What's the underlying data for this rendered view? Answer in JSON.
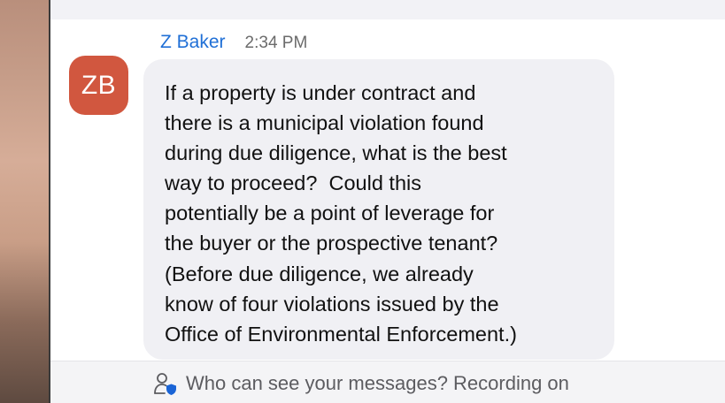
{
  "message": {
    "avatar_initials": "ZB",
    "sender": "Z Baker",
    "time": "2:34 PM",
    "lines": [
      "If a property is under contract and",
      "there is a municipal violation found",
      "during due diligence, what is the best",
      "way to proceed?  Could this",
      "potentially be a point of leverage for",
      "the buyer or the prospective tenant?",
      "(Before due diligence, we already",
      "know of four violations issued by the",
      "Office of Environmental Enforcement.)"
    ]
  },
  "footer": {
    "privacy_text": "Who can see your messages? Recording on",
    "icon": "user-shield-icon"
  },
  "colors": {
    "avatar_bg": "#d1573f",
    "sender_name": "#1f6fd6",
    "bubble_bg": "#f0f0f4",
    "shield": "#1a64d6"
  }
}
